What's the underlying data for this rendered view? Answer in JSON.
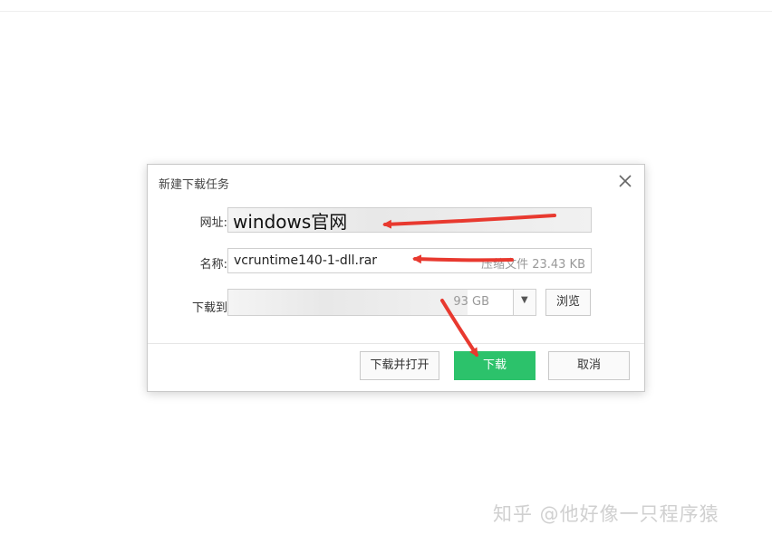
{
  "dialog": {
    "title": "新建下载任务",
    "close_icon": "close-icon"
  },
  "form": {
    "url_label": "网址:",
    "url_value": "windows官网",
    "name_label": "名称:",
    "name_value": "vcruntime140-1-dll.rar",
    "name_hint": "压缩文件 23.43 KB",
    "save_label": "下载到",
    "save_space": "93 GB",
    "browse_label": "浏览"
  },
  "buttons": {
    "download_open": "下载并打开",
    "download": "下载",
    "cancel": "取消"
  },
  "watermark": "知乎 @他好像一只程序猿",
  "colors": {
    "primary": "#2cc26b",
    "annotation": "#e8392f"
  }
}
